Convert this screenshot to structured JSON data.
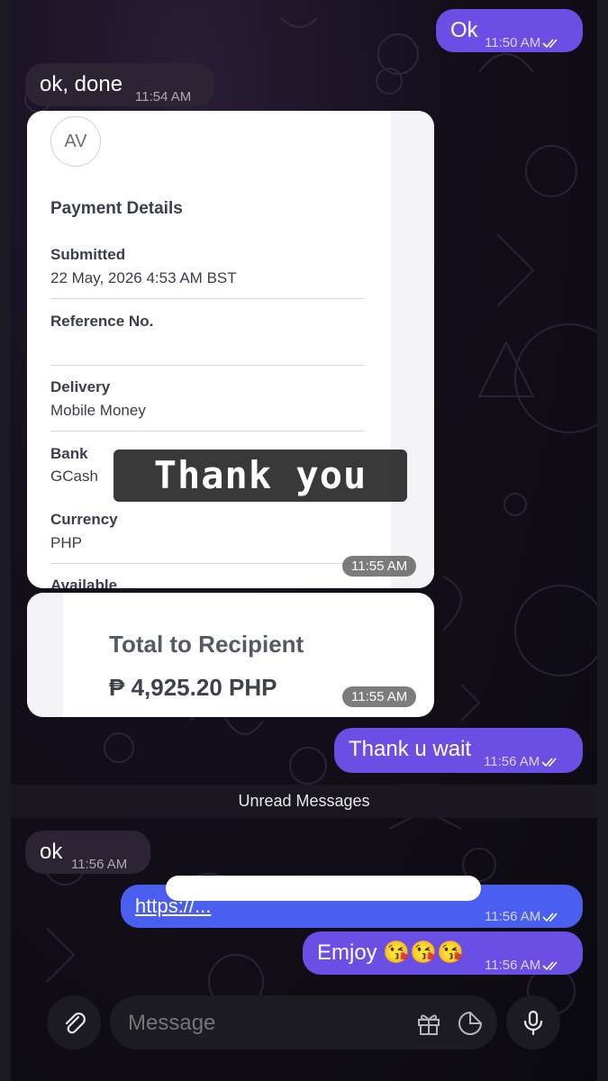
{
  "messages": [
    {
      "text": "Ok",
      "time": "11:50 AM",
      "direction": "out"
    },
    {
      "text": "ok, done",
      "time": "11:54 AM",
      "direction": "in"
    },
    {
      "text": "Thank u wait",
      "time": "11:56 AM",
      "direction": "out"
    },
    {
      "text": "ok",
      "time": "11:56 AM",
      "direction": "in"
    },
    {
      "text": "https://...",
      "time": "11:56 AM",
      "direction": "out"
    },
    {
      "text": "Emjoy 😘😘😘",
      "time": "11:56 AM",
      "direction": "out"
    }
  ],
  "receipt_photo": {
    "avatar_initials": "AV",
    "heading": "Payment Details",
    "fields": [
      {
        "label": "Submitted",
        "value": "22 May, 2026 4:53 AM BST"
      },
      {
        "label": "Reference No.",
        "value": ""
      },
      {
        "label": "Delivery",
        "value": "Mobile Money"
      },
      {
        "label": "Bank",
        "value": "GCash"
      },
      {
        "label": "Currency",
        "value": "PHP"
      },
      {
        "label": "Available",
        "value": ""
      }
    ],
    "time": "11:55 AM",
    "sticker_text": "Thank you"
  },
  "total_photo": {
    "label": "Total to Recipient",
    "amount": "₱ 4,925.20 PHP",
    "time": "11:55 AM"
  },
  "unread_divider": "Unread Messages",
  "composer": {
    "placeholder": "Message"
  },
  "colors": {
    "outgoing_bubble": "#6a4fe4",
    "incoming_bubble": "#2c2433",
    "link_bubble": "#4a5ff0"
  },
  "icons": [
    "paperclip-icon",
    "gift-icon",
    "sticker-icon",
    "microphone-icon",
    "double-check-icon"
  ]
}
